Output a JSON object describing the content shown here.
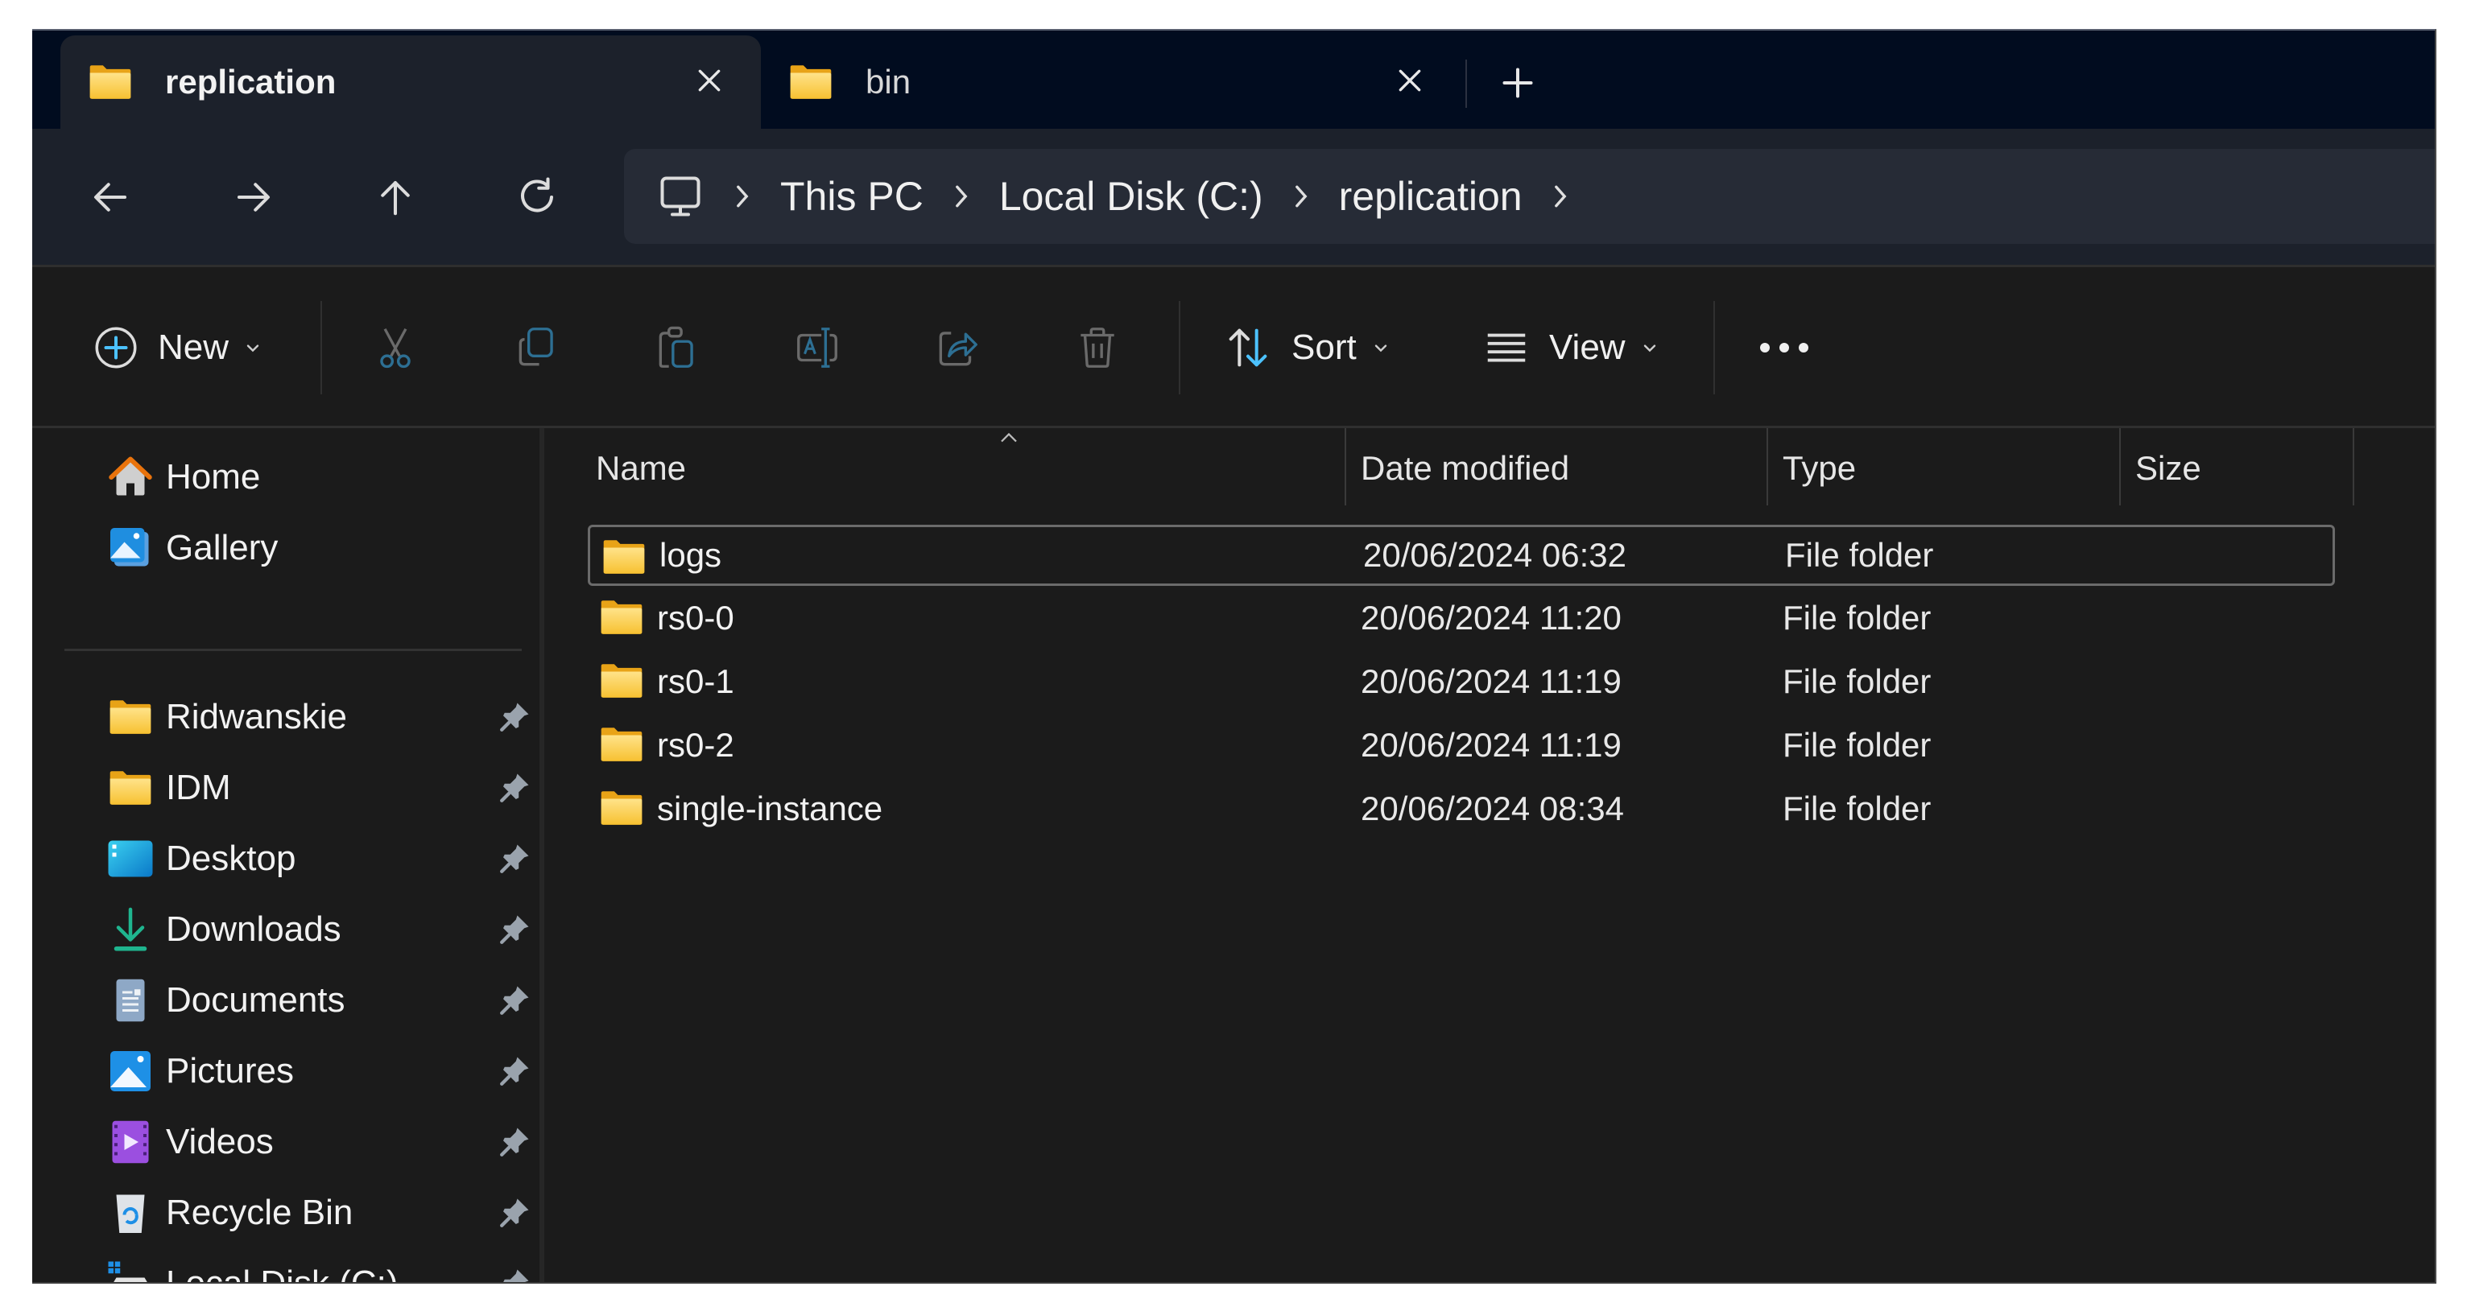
{
  "tabs": [
    {
      "label": "replication",
      "icon": "folder-icon",
      "active": true,
      "close_icon": "close-icon"
    },
    {
      "label": "bin",
      "icon": "folder-icon",
      "active": false,
      "close_icon": "close-icon"
    }
  ],
  "new_tab_icon": "plus-icon",
  "navigation": {
    "back_icon": "arrow-left-icon",
    "forward_icon": "arrow-right-icon",
    "up_icon": "arrow-up-icon",
    "refresh_icon": "refresh-icon"
  },
  "breadcrumb": {
    "root_icon": "monitor-icon",
    "items": [
      "This PC",
      "Local Disk (C:)",
      "replication"
    ]
  },
  "toolbar": {
    "new_label": "New",
    "sort_label": "Sort",
    "view_label": "View",
    "actions": [
      "cut",
      "copy",
      "paste",
      "rename",
      "share",
      "delete"
    ],
    "more_icon": "more-icon"
  },
  "sidebar": {
    "top_items": [
      {
        "label": "Home",
        "icon": "home-icon"
      },
      {
        "label": "Gallery",
        "icon": "gallery-icon"
      }
    ],
    "pinned_items": [
      {
        "label": "Ridwanskie",
        "icon": "folder-icon",
        "pinned": true
      },
      {
        "label": "IDM",
        "icon": "folder-icon",
        "pinned": true
      },
      {
        "label": "Desktop",
        "icon": "desktop-icon",
        "pinned": true
      },
      {
        "label": "Downloads",
        "icon": "download-icon",
        "pinned": true
      },
      {
        "label": "Documents",
        "icon": "documents-icon",
        "pinned": true
      },
      {
        "label": "Pictures",
        "icon": "pictures-icon",
        "pinned": true
      },
      {
        "label": "Videos",
        "icon": "videos-icon",
        "pinned": true
      },
      {
        "label": "Recycle Bin",
        "icon": "recycle-bin-icon",
        "pinned": true
      },
      {
        "label": "Local Disk (C:)",
        "icon": "drive-icon",
        "pinned": true
      }
    ]
  },
  "file_list": {
    "columns": [
      "Name",
      "Date modified",
      "Type",
      "Size"
    ],
    "sort_column": "Name",
    "sort_direction": "ascending",
    "rows": [
      {
        "name": "logs",
        "date": "20/06/2024 06:32",
        "type": "File folder",
        "size": "",
        "selected": true
      },
      {
        "name": "rs0-0",
        "date": "20/06/2024 11:20",
        "type": "File folder",
        "size": "",
        "selected": false
      },
      {
        "name": "rs0-1",
        "date": "20/06/2024 11:19",
        "type": "File folder",
        "size": "",
        "selected": false
      },
      {
        "name": "rs0-2",
        "date": "20/06/2024 11:19",
        "type": "File folder",
        "size": "",
        "selected": false
      },
      {
        "name": "single-instance",
        "date": "20/06/2024 08:34",
        "type": "File folder",
        "size": "",
        "selected": false
      }
    ]
  },
  "colors": {
    "accent": "#4cc2ff",
    "folder": "#ffc83d",
    "tabbar_bg": "#010c1f",
    "address_bg": "#1c212b",
    "content_bg": "#1b1b1b"
  }
}
